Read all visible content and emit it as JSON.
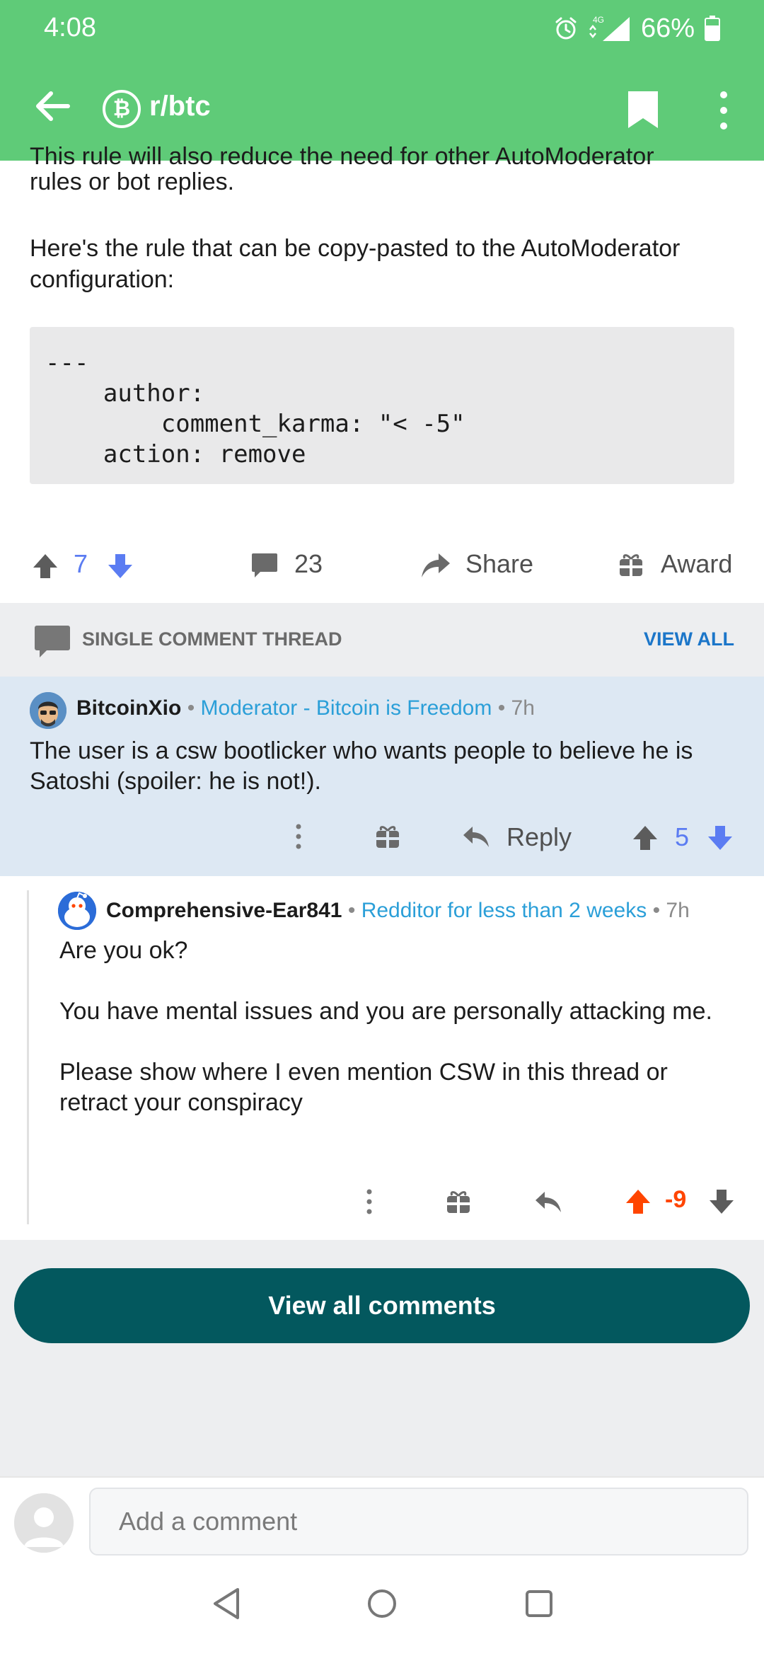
{
  "status_bar": {
    "time": "4:08",
    "network": "4G",
    "battery": "66%"
  },
  "app_bar": {
    "subreddit": "r/btc",
    "subreddit_icon_glyph": "₿",
    "color": "#5fcb78"
  },
  "post": {
    "clipped_line": "This rule will also reduce the need for other AutoModerator",
    "line1": "rules or bot replies.",
    "para2": "Here's the rule that can be copy-pasted to the AutoModerator configuration:",
    "code": "---\n    author:\n        comment_karma: \"< -5\"\n    action: remove",
    "score": "7",
    "comments": "23",
    "share_label": "Share",
    "award_label": "Award"
  },
  "thread": {
    "header_label": "SINGLE COMMENT THREAD",
    "view_all_label": "VIEW ALL"
  },
  "comments": [
    {
      "author": "BitcoinXio",
      "flair": "Moderator - Bitcoin is Freedom",
      "time": "7h",
      "text": "The user is a csw bootlicker who wants people to believe he is Satoshi (spoiler: he is not!).",
      "reply_label": "Reply",
      "score": "5",
      "score_color": "#5b7cf2"
    },
    {
      "author": "Comprehensive-Ear841",
      "flair": "Redditor for less than 2 weeks",
      "time": "7h",
      "text": "Are you ok?\n\nYou have mental issues and you are personally attacking me.\n\nPlease show where I even mention CSW in this thread or retract your conspiracy",
      "score": "-9",
      "score_color": "#ff4500"
    }
  ],
  "view_all_comments_label": "View all comments",
  "composer": {
    "placeholder": "Add a comment"
  }
}
